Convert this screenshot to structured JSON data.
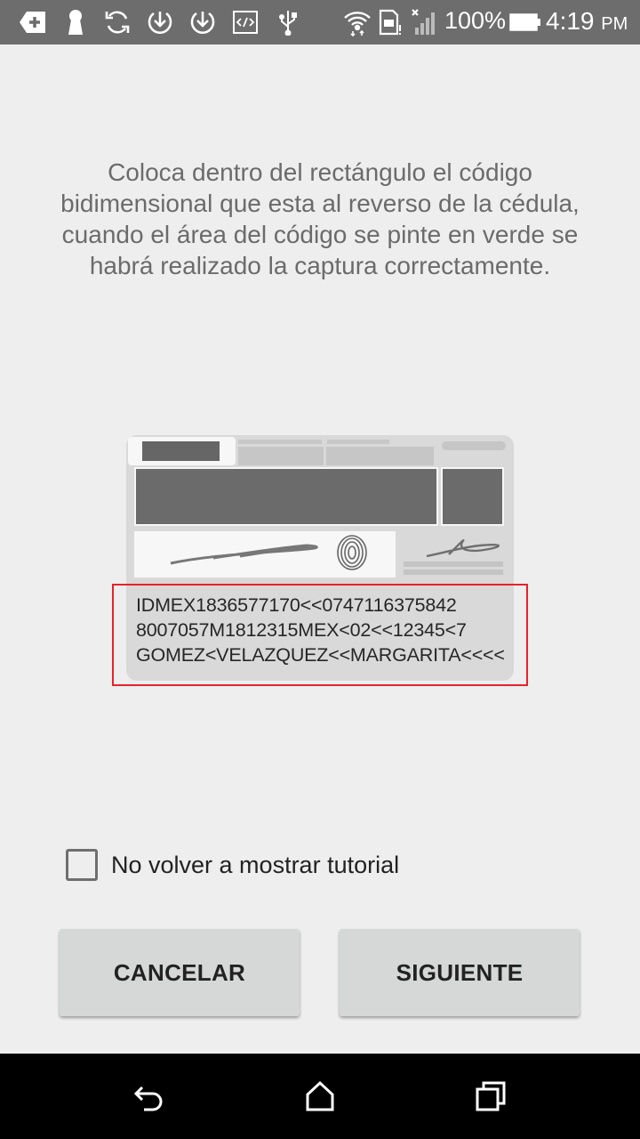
{
  "status_bar": {
    "icons": [
      "add-box-icon",
      "keyhole-icon",
      "sync-icon",
      "download-circle-icon",
      "download-circle-icon",
      "code-icon",
      "usb-icon",
      "wifi-icon",
      "sim-icon",
      "signal-icon",
      "battery-icon"
    ],
    "battery": "100%",
    "time": "4:19",
    "ampm": "PM"
  },
  "instruction": "Coloca dentro del rectángulo el código bidimensional que esta al reverso de la cédula, cuando el área del código se pinte en verde se habrá realizado la captura correctamente.",
  "card": {
    "mrz_line1": "IDMEX1836577170<<0747116375842",
    "mrz_line2": "8007057M1812315MEX<02<<12345<7",
    "mrz_line3": "GOMEZ<VELAZQUEZ<<MARGARITA<<<<",
    "scan_frame_color": "#e8222a"
  },
  "checkbox": {
    "label": "No volver a mostrar tutorial",
    "checked": false
  },
  "buttons": {
    "cancel": "CANCELAR",
    "next": "SIGUIENTE"
  },
  "nav_bar": {
    "icons": [
      "back-icon",
      "home-icon",
      "recents-icon"
    ]
  }
}
